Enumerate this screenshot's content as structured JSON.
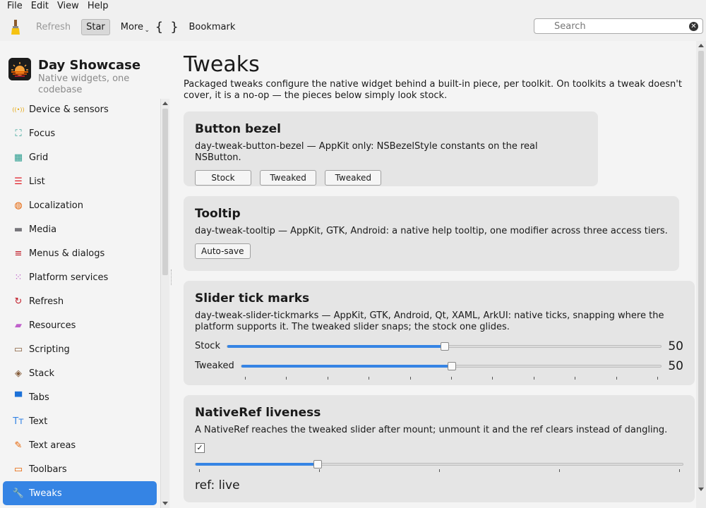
{
  "menubar": {
    "items": [
      "File",
      "Edit",
      "View",
      "Help"
    ]
  },
  "toolbar": {
    "refresh_label": "Refresh",
    "star_label": "Star",
    "more_label": "More",
    "braces_label": "{ }",
    "bookmark_label": "Bookmark",
    "search_placeholder": "Search",
    "search_value": ""
  },
  "sidebar": {
    "app_title": "Day Showcase",
    "app_subtitle": "Native widgets, one codebase",
    "items": [
      {
        "label": "Device & sensors",
        "icon": "sensors-icon",
        "glyph": "((•))",
        "color": "#e5a50a"
      },
      {
        "label": "Focus",
        "icon": "focus-icon",
        "glyph": "⛶",
        "color": "#2a9d8f"
      },
      {
        "label": "Grid",
        "icon": "grid-icon",
        "glyph": "▦",
        "color": "#2a9d8f"
      },
      {
        "label": "List",
        "icon": "list-icon",
        "glyph": "☰",
        "color": "#e01b24"
      },
      {
        "label": "Localization",
        "icon": "globe-icon",
        "glyph": "◍",
        "color": "#e66100"
      },
      {
        "label": "Media",
        "icon": "clapper-icon",
        "glyph": "▬",
        "color": "#77767b"
      },
      {
        "label": "Menus & dialogs",
        "icon": "menu-icon",
        "glyph": "≡",
        "color": "#c01c28"
      },
      {
        "label": "Platform services",
        "icon": "dots-grid-icon",
        "glyph": "⁙",
        "color": "#c061cb"
      },
      {
        "label": "Refresh",
        "icon": "refresh-icon",
        "glyph": "↻",
        "color": "#c01c28"
      },
      {
        "label": "Resources",
        "icon": "folder-icon",
        "glyph": "▰",
        "color": "#c061cb"
      },
      {
        "label": "Scripting",
        "icon": "terminal-icon",
        "glyph": "▭",
        "color": "#865e3c"
      },
      {
        "label": "Stack",
        "icon": "layers-icon",
        "glyph": "◈",
        "color": "#865e3c"
      },
      {
        "label": "Tabs",
        "icon": "tabs-icon",
        "glyph": "▀",
        "color": "#1c71d8"
      },
      {
        "label": "Text",
        "icon": "text-icon",
        "glyph": "Tт",
        "color": "#3584e4"
      },
      {
        "label": "Text areas",
        "icon": "edit-icon",
        "glyph": "✎",
        "color": "#e66100"
      },
      {
        "label": "Toolbars",
        "icon": "window-icon",
        "glyph": "▭",
        "color": "#e66100"
      },
      {
        "label": "Tweaks",
        "icon": "wrench-icon",
        "glyph": "🔧",
        "color": "#2ec27e",
        "active": true
      }
    ]
  },
  "main": {
    "title": "Tweaks",
    "description": "Packaged tweaks configure the native widget behind a built-in piece, per toolkit. On toolkits a tweak doesn't cover, it is a no-op — the pieces below simply look stock.",
    "cards": {
      "bezel": {
        "title": "Button bezel",
        "desc": "day-tweak-button-bezel — AppKit only: NSBezelStyle constants on the real NSButton.",
        "buttons": [
          "Stock",
          "Tweaked",
          "Tweaked"
        ]
      },
      "tooltip": {
        "title": "Tooltip",
        "desc": "day-tweak-tooltip — AppKit, GTK, Android: a native help tooltip, one modifier across three access tiers.",
        "button": "Auto-save"
      },
      "ticks": {
        "title": "Slider tick marks",
        "desc": "day-tweak-slider-tickmarks — AppKit, GTK, Android, Qt, XAML, ArkUI: native ticks, snapping where the platform supports it. The tweaked slider snaps; the stock one glides.",
        "stock_label": "Stock",
        "stock_value": 50,
        "stock_value_text": "50",
        "tweaked_label": "Tweaked",
        "tweaked_value": 50,
        "tweaked_value_text": "50",
        "tick_count": 11,
        "max": 100
      },
      "nativeref": {
        "title": "NativeRef liveness",
        "desc": "A NativeRef reaches the tweaked slider after mount; unmount it and the ref clears instead of dangling.",
        "checked": true,
        "check_glyph": "✓",
        "slider_value": 25,
        "tick_count": 5,
        "max": 100,
        "ref_text": "ref: live"
      }
    }
  },
  "colors": {
    "accent": "#3584e4",
    "card_bg": "#e5e5e5",
    "window_bg": "#f4f4f4"
  }
}
